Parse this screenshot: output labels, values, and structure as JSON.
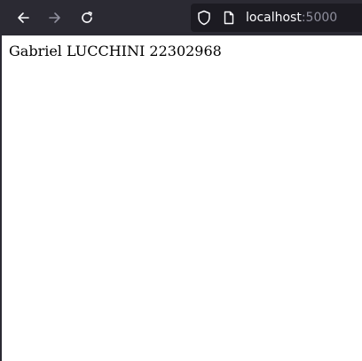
{
  "browser": {
    "toolbar": {
      "back_icon": "arrow-left-icon",
      "forward_icon": "arrow-right-icon",
      "reload_icon": "reload-icon",
      "forward_enabled": false
    },
    "address_bar": {
      "security_icon": "shield-icon",
      "page_icon": "page-icon",
      "host": "localhost",
      "port": ":5000"
    },
    "colors": {
      "toolbar_bg": "#2b2a33",
      "urlbar_bg": "#1c1b22",
      "icon_active": "#fbfbfe",
      "icon_disabled": "#8f8f9d"
    }
  },
  "page": {
    "text": "Gabriel LUCCHINI 22302968"
  }
}
